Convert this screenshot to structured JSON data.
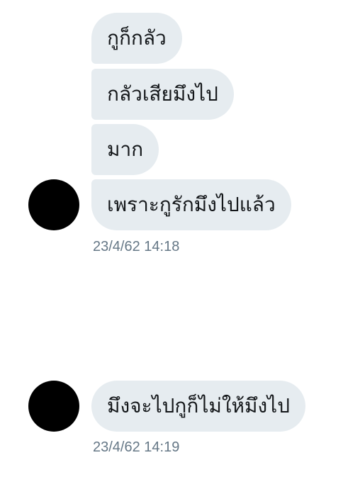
{
  "thread": {
    "group1": {
      "messages": [
        "กูก็กลัว",
        "กลัวเสียมึงไป",
        "มาก",
        "เพราะกูรักมึงไปแล้ว"
      ],
      "timestamp": "23/4/62 14:18"
    },
    "group2": {
      "messages": [
        "มึงจะไปกูก็ไม่ให้มึงไป"
      ],
      "timestamp": "23/4/62 14:19"
    }
  }
}
